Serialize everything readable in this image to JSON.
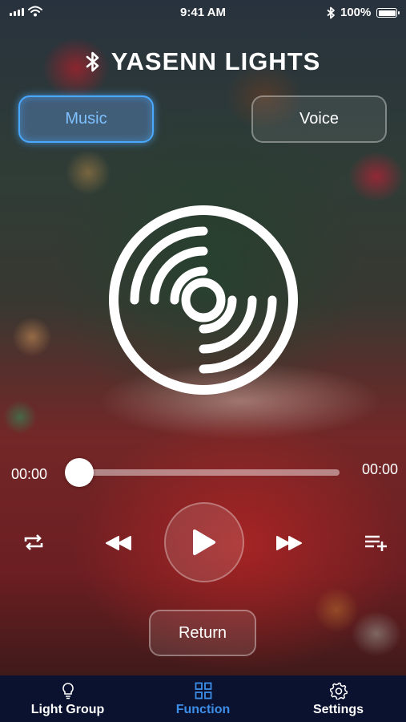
{
  "status_bar": {
    "time": "9:41 AM",
    "battery_percent": "100%",
    "icons": [
      "signal-icon",
      "wifi-icon",
      "bluetooth-icon",
      "battery-icon"
    ]
  },
  "header": {
    "title": "YASENN LIGHTS",
    "icon": "bluetooth-icon"
  },
  "mode_tabs": {
    "music_label": "Music",
    "voice_label": "Voice",
    "selected": "Music"
  },
  "player": {
    "disc_icon": "vinyl-disc-icon",
    "elapsed": "00:00",
    "duration": "00:00",
    "progress": 0,
    "controls": [
      "repeat-icon",
      "rewind-icon",
      "play-icon",
      "fast-forward-icon",
      "add-to-playlist-icon"
    ]
  },
  "return_label": "Return",
  "tab_bar": {
    "items": [
      {
        "label": "Light Group",
        "icon": "lightbulb-icon"
      },
      {
        "label": "Function",
        "icon": "grid-icon"
      },
      {
        "label": "Settings",
        "icon": "gear-icon"
      }
    ],
    "active": "Function"
  },
  "colors": {
    "accent": "#4aa8ff",
    "active_tab": "#3d8ee8",
    "tab_bar_bg": "#0a1230"
  }
}
